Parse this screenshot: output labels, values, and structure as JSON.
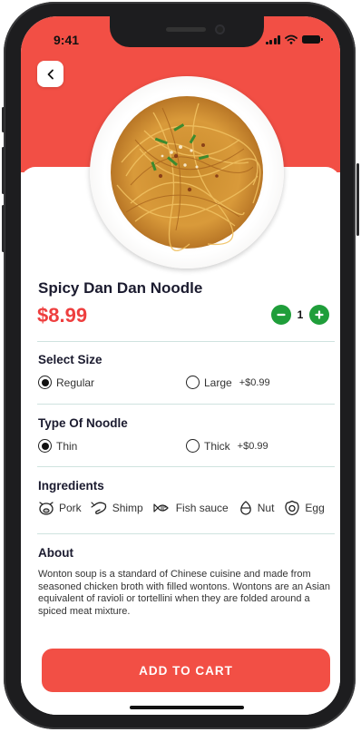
{
  "status_bar": {
    "time": "9:41"
  },
  "product": {
    "name": "Spicy Dan Dan Noodle",
    "price": "$8.99",
    "quantity": "1"
  },
  "size": {
    "title": "Select Size",
    "options": [
      {
        "label": "Regular",
        "extra": "",
        "selected": true
      },
      {
        "label": "Large",
        "extra": "+$0.99",
        "selected": false
      }
    ]
  },
  "noodle": {
    "title": "Type Of Noodle",
    "options": [
      {
        "label": "Thin",
        "extra": "",
        "selected": true
      },
      {
        "label": "Thick",
        "extra": "+$0.99",
        "selected": false
      }
    ]
  },
  "ingredients": {
    "title": "Ingredients",
    "items": [
      {
        "label": "Pork",
        "icon": "pig-icon"
      },
      {
        "label": "Shimp",
        "icon": "shrimp-icon"
      },
      {
        "label": "Fish sauce",
        "icon": "fish-icon"
      },
      {
        "label": "Nut",
        "icon": "nut-icon"
      },
      {
        "label": "Egg",
        "icon": "egg-icon"
      }
    ]
  },
  "about": {
    "title": "About",
    "text": "Wonton soup is a standard of Chinese cuisine and made from seasoned chicken broth with filled wontons. Wontons are an Asian equivalent of ravioli or tortellini when they are folded around a spiced meat mixture."
  },
  "cta": {
    "label": "ADD TO CART"
  },
  "colors": {
    "accent": "#f24f45",
    "price": "#ee3f3f",
    "stepper": "#1f9e3a",
    "text": "#1b1b2f"
  }
}
